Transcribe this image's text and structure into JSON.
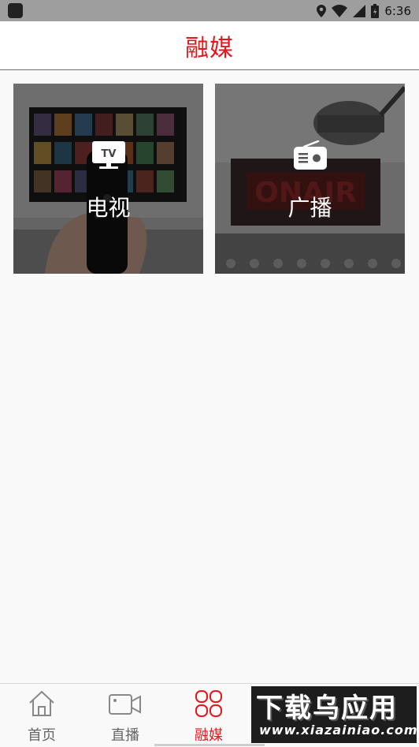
{
  "status_bar": {
    "time": "6:36",
    "icons": [
      "location-icon",
      "wifi-icon",
      "signal-icon",
      "battery-icon"
    ]
  },
  "app_bar": {
    "title": "融媒"
  },
  "tiles": [
    {
      "id": "tv",
      "label": "电视",
      "icon": "tv-icon",
      "icon_text": "TV"
    },
    {
      "id": "radio",
      "label": "广播",
      "icon": "radio-icon"
    }
  ],
  "tabs": [
    {
      "label": "首页",
      "icon": "home-icon",
      "active": false
    },
    {
      "label": "直播",
      "icon": "video-camera-icon",
      "active": false
    },
    {
      "label": "融媒",
      "icon": "grid-icon",
      "active": true
    }
  ],
  "watermark": {
    "title": "下载乌应用",
    "url": "www.xiazainiao.com"
  },
  "colors": {
    "accent": "#e8161b",
    "tab_inactive": "#666666",
    "status_bar": "#9e9e9e",
    "background": "#f9f9f9"
  }
}
